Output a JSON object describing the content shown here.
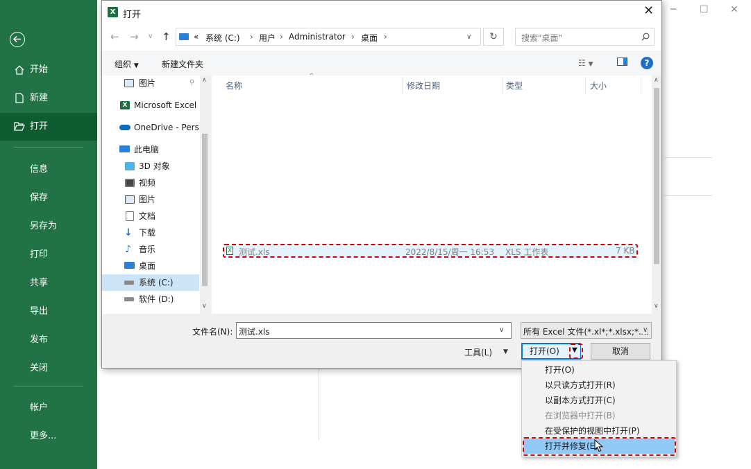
{
  "backstage": {
    "nav": [
      {
        "label": "开始",
        "icon": "home-icon"
      },
      {
        "label": "新建",
        "icon": "new-doc-icon"
      },
      {
        "label": "打开",
        "icon": "folder-open-icon",
        "active": true
      }
    ],
    "menu": [
      "信息",
      "保存",
      "另存为",
      "打印",
      "共享",
      "导出",
      "发布",
      "关闭"
    ],
    "footer": [
      "帐户",
      "更多..."
    ]
  },
  "dialog": {
    "title": "打开",
    "address": {
      "prefix": "«",
      "crumbs": [
        "系统 (C:)",
        "用户",
        "Administrator",
        "桌面"
      ]
    },
    "search_placeholder": "搜索\"桌面\"",
    "toolbar": {
      "organize": "组织",
      "new_folder": "新建文件夹"
    },
    "nav_pane": {
      "quick_item": "图片",
      "excel": "Microsoft Excel",
      "onedrive": "OneDrive - Perso",
      "this_pc": "此电脑",
      "pc_items": [
        "3D 对象",
        "视频",
        "图片",
        "文档",
        "下载",
        "音乐",
        "桌面",
        "系统 (C:)",
        "软件 (D:)"
      ]
    },
    "columns": [
      "名称",
      "修改日期",
      "类型",
      "大小"
    ],
    "files": [
      {
        "name": "测试.xls",
        "date": "2022/8/15/周一 16:53",
        "type": "XLS 工作表",
        "size": "7 KB"
      }
    ],
    "filename_label": "文件名(N):",
    "filename_value": "测试.xls",
    "filter": "所有 Excel 文件(*.xl*;*.xlsx;*.xl",
    "tools_label": "工具(L)",
    "open_label": "打开(O)",
    "cancel_label": "取消"
  },
  "open_menu": {
    "items": [
      {
        "label": "打开(O)",
        "state": "normal"
      },
      {
        "label": "以只读方式打开(R)",
        "state": "normal"
      },
      {
        "label": "以副本方式打开(C)",
        "state": "normal"
      },
      {
        "label": "在浏览器中打开(B)",
        "state": "disabled"
      },
      {
        "label": "在受保护的视图中打开(P)",
        "state": "normal"
      },
      {
        "label": "打开并修复(E)",
        "state": "highlighted"
      }
    ]
  },
  "colors": {
    "excel_green": "#217346",
    "highlight_red": "#d40000",
    "menu_highlight": "#91c9f7"
  }
}
